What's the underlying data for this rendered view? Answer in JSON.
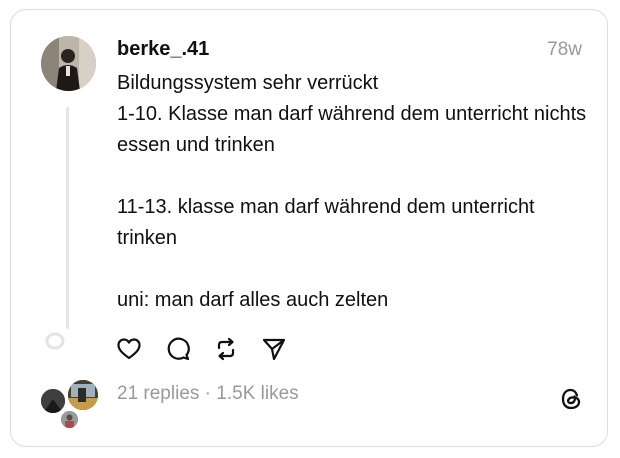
{
  "post": {
    "username": "berke_.41",
    "timestamp": "78w",
    "lines": [
      "Bildungssystem sehr verrückt",
      "1-10. Klasse man darf während dem unterricht nichts essen und trinken",
      "11-13. klasse man darf während dem unterricht trinken",
      "uni: man darf alles auch zelten"
    ]
  },
  "actions": {
    "like_icon": "heart-icon",
    "reply_icon": "comment-icon",
    "repost_icon": "repost-icon",
    "share_icon": "send-icon"
  },
  "stats": {
    "replies": "21 replies",
    "separator": "·",
    "likes": "1.5K likes"
  },
  "colors": {
    "text": "#101010",
    "muted": "#999999",
    "border": "#dcdcdc"
  }
}
